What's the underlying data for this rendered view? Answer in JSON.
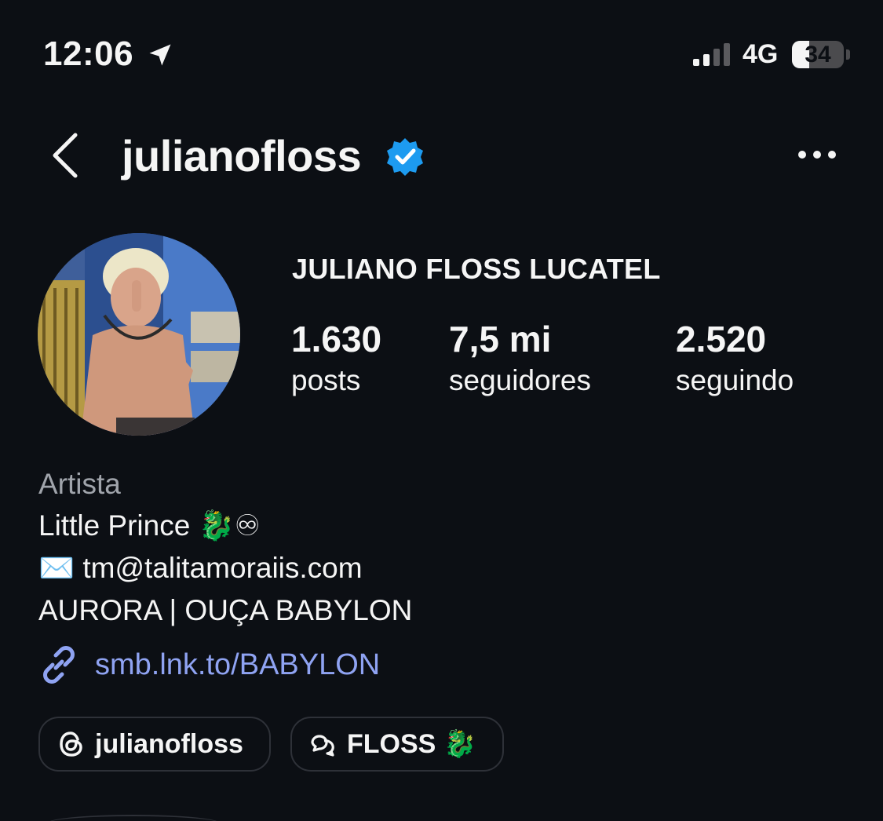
{
  "status_bar": {
    "time": "12:06",
    "network": "4G",
    "battery": "34",
    "battery_level": 0.34,
    "icons": [
      "location-arrow-icon",
      "cellular-signal-icon",
      "battery-icon"
    ]
  },
  "header": {
    "username": "julianofloss",
    "verified": true,
    "icons": [
      "chevron-left-icon",
      "verified-badge-icon",
      "more-options-icon"
    ]
  },
  "profile": {
    "full_name": "JULIANO FLOSS LUCATEL",
    "stats": [
      {
        "value": "1.630",
        "label": "posts"
      },
      {
        "value": "7,5 mi",
        "label": "seguidores"
      },
      {
        "value": "2.520",
        "label": "seguindo"
      }
    ]
  },
  "bio": {
    "category": "Artista",
    "line1": "Little Prince 🐉♾",
    "line2": "✉️ tm@talitamoraiis.com",
    "line3": "AURORA | OUÇA BABYLON"
  },
  "link": {
    "text": "smb.lnk.to/BABYLON",
    "icon": "link-icon"
  },
  "pills": [
    {
      "label": "julianofloss",
      "icon": "threads-icon"
    },
    {
      "label": "FLOSS 🐉",
      "icon": "chat-bubbles-icon"
    }
  ],
  "colors": {
    "background": "#0c0f14",
    "text": "#f5f5f5",
    "muted": "#a0a4ab",
    "link": "#8fa3f2",
    "verified": "#1d9bf0"
  }
}
